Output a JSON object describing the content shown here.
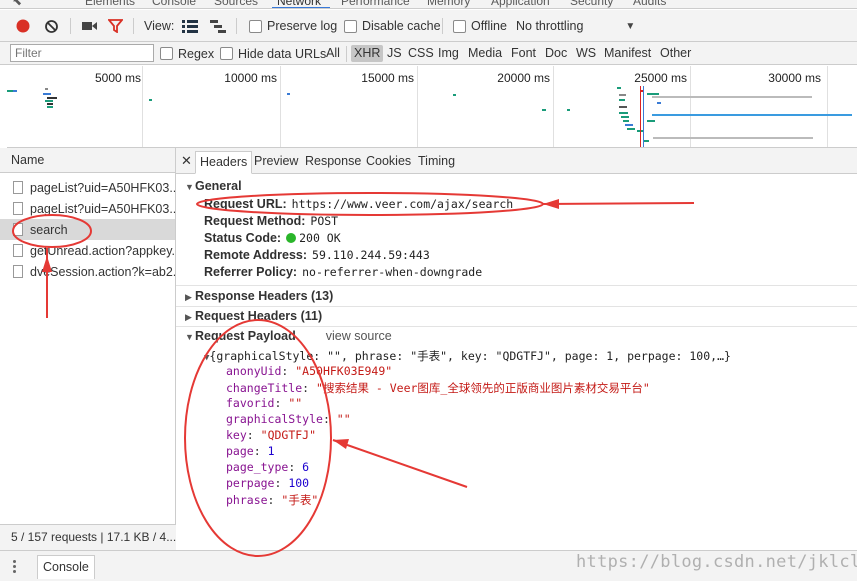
{
  "devtools_tabs": [
    "Elements",
    "Console",
    "Sources",
    "Network",
    "Performance",
    "Memory",
    "Application",
    "Security",
    "Audits"
  ],
  "toolbar": {
    "view_label": "View:",
    "preserve_log": "Preserve log",
    "disable_cache": "Disable cache",
    "offline": "Offline",
    "throttling": "No throttling",
    "colors": {
      "record": "#d93025",
      "filter": "#d93025"
    }
  },
  "filter_bar": {
    "placeholder": "Filter",
    "regex": "Regex",
    "hide_data_urls": "Hide data URLs",
    "types": [
      "All",
      "XHR",
      "JS",
      "CSS",
      "Img",
      "Media",
      "Font",
      "Doc",
      "WS",
      "Manifest",
      "Other"
    ],
    "active_type": "XHR"
  },
  "overview": {
    "ticks": [
      "5000 ms",
      "10000 ms",
      "15000 ms",
      "20000 ms",
      "25000 ms",
      "30000 ms"
    ]
  },
  "requests": {
    "header": "Name",
    "items": [
      "pageList?uid=A50HFK03...",
      "pageList?uid=A50HFK03...",
      "search",
      "getUnread.action?appkey...",
      "dveSession.action?k=ab2..."
    ],
    "selected_index": 2,
    "status": "5 / 157 requests  |  17.1 KB / 4..."
  },
  "detail_tabs": [
    "Headers",
    "Preview",
    "Response",
    "Cookies",
    "Timing"
  ],
  "active_detail_tab": "Headers",
  "general": {
    "title": "General",
    "request_url_key": "Request URL:",
    "request_url": "https://www.veer.com/ajax/search",
    "request_method_key": "Request Method:",
    "request_method": "POST",
    "status_code_key": "Status Code:",
    "status_code": "200 OK",
    "remote_address_key": "Remote Address:",
    "remote_address": "59.110.244.59:443",
    "referrer_policy_key": "Referrer Policy:",
    "referrer_policy": "no-referrer-when-downgrade"
  },
  "response_headers": "Response Headers (13)",
  "request_headers": "Request Headers (11)",
  "payload": {
    "title": "Request Payload",
    "view_source": "view source",
    "summary": "{graphicalStyle: \"\", phrase: \"手表\", key: \"QDGTFJ\", page: 1, perpage: 100,…}",
    "fields": [
      {
        "key": "anonyUid",
        "value": "\"A50HFK03E949\"",
        "kind": "string"
      },
      {
        "key": "changeTitle",
        "value": "\"搜索结果 - Veer图库_全球领先的正版商业图片素材交易平台\"",
        "kind": "string"
      },
      {
        "key": "favorid",
        "value": "\"\"",
        "kind": "string"
      },
      {
        "key": "graphicalStyle",
        "value": "\"\"",
        "kind": "string"
      },
      {
        "key": "key",
        "value": "\"QDGTFJ\"",
        "kind": "string"
      },
      {
        "key": "page",
        "value": "1",
        "kind": "number"
      },
      {
        "key": "page_type",
        "value": "6",
        "kind": "number"
      },
      {
        "key": "perpage",
        "value": "100",
        "kind": "number"
      },
      {
        "key": "phrase",
        "value": "\"手表\"",
        "kind": "string"
      }
    ]
  },
  "drawer": {
    "console_tab": "Console"
  },
  "watermark": "https://blog.csdn.net/jklcl",
  "annotation_color": "#e53935"
}
